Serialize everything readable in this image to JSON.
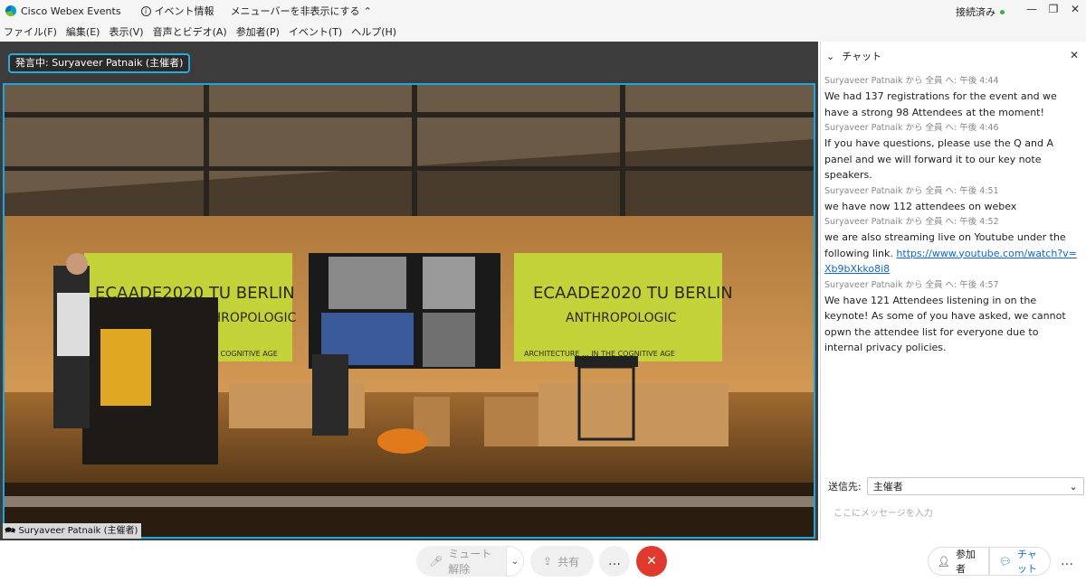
{
  "titlebar": {
    "app_name": "Cisco Webex Events",
    "event_info": "イベント情報",
    "hide_menu": "メニューバーを非表示にする",
    "status": "接続済み"
  },
  "menu": [
    "ファイル(F)",
    "編集(E)",
    "表示(V)",
    "音声とビデオ(A)",
    "参加者(P)",
    "イベント(T)",
    "ヘルプ(H)"
  ],
  "video": {
    "speaking_badge": "発言中: Suryaveer Patnaik (主催者)",
    "name_tag": "Suryaveer Patnaik (主催者)",
    "screen_left_1": "ECAADE2020 TU BERLIN",
    "screen_left_2": "ANTHROPOLOGIC",
    "screen_left_3": "THE COGNITIVE AGE",
    "screen_right_1": "ECAADE2020 TU BERLIN",
    "screen_right_2": "ANTHROPOLOGIC",
    "screen_right_3": "ARCHITECTURE ... IN THE COGNITIVE AGE"
  },
  "chat": {
    "title": "チャット",
    "messages": [
      {
        "meta": "Suryaveer Patnaik から 全員 へ:   午後 4:44",
        "text": "We had 137 registrations for the event and we have a strong 98 Attendees at the moment!"
      },
      {
        "meta": "Suryaveer Patnaik から 全員 へ:   午後 4:46",
        "text": "If you have questions, please use the Q and A panel and we will forward it to our key note speakers."
      },
      {
        "meta": "Suryaveer Patnaik から 全員 へ:   午後 4:51",
        "text": "we have now 112 attendees on webex"
      },
      {
        "meta": "Suryaveer Patnaik から 全員 へ:   午後 4:52",
        "text": "we are also streaming live on Youtube under the following link. ",
        "link": "https://www.youtube.com/watch?v=Xb9bXkko8i8"
      },
      {
        "meta": "Suryaveer Patnaik から 全員 へ:   午後 4:57",
        "text": "We have 121 Attendees listening in on the keynote! As some of you have asked, we cannot opwn the attendee list for everyone due to internal privacy policies."
      }
    ],
    "recipient_label": "送信先:",
    "recipient_value": "主催者",
    "input_placeholder": "ここにメッセージを入力"
  },
  "toolbar": {
    "unmute": "ミュート解除",
    "share": "共有",
    "more": "…",
    "participants": "参加者",
    "chat": "チャット",
    "more_right": "…"
  },
  "colors": {
    "accent": "#1da7e2",
    "end": "#e03a2e",
    "screen_green": "#c4d23a"
  }
}
